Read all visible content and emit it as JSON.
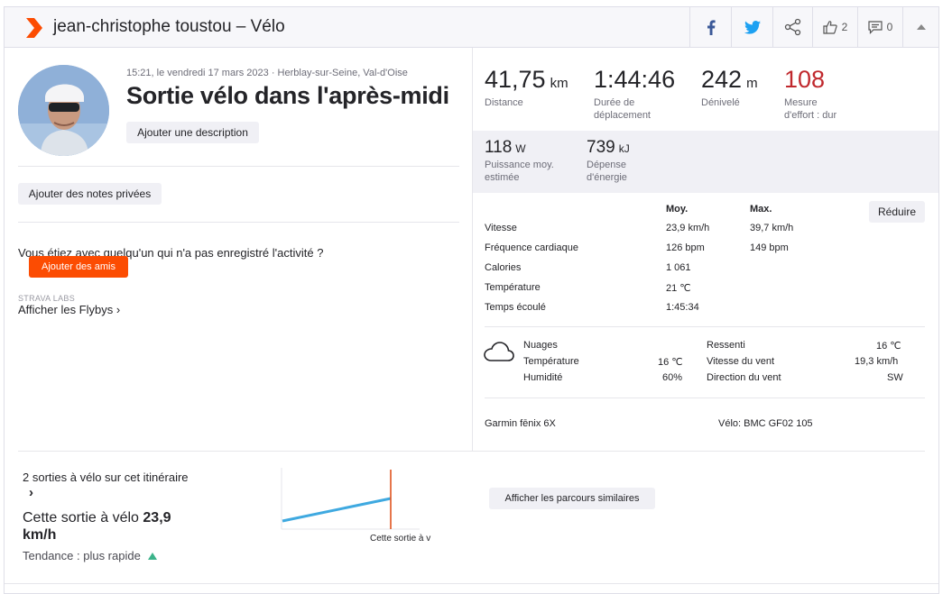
{
  "header": {
    "title": "jean-christophe toustou – Vélo",
    "kudos_count": "2",
    "comments_count": "0"
  },
  "activity": {
    "datetime_location": "15:21, le vendredi 17 mars 2023 · Herblay-sur-Seine, Val-d'Oise",
    "title": "Sortie vélo dans l'après-midi",
    "add_description": "Ajouter une description",
    "add_private_notes": "Ajouter des notes privées",
    "with_question": "Vous étiez avec quelqu'un qui n'a pas enregistré l'activité ?",
    "add_friends": "Ajouter des amis",
    "labs_label": "STRAVA LABS",
    "flybys_link": "Afficher les Flybys ›"
  },
  "stats": {
    "distance": {
      "value": "41,75",
      "unit": "km",
      "label": "Distance"
    },
    "moving_time": {
      "value": "1:44:46",
      "label": "Durée de\ndéplacement"
    },
    "elevation": {
      "value": "242",
      "unit": "m",
      "label": "Dénivelé"
    },
    "effort": {
      "value": "108",
      "label": "Mesure\nd'effort : dur"
    },
    "power": {
      "value": "118",
      "unit": "W",
      "label": "Puissance moy.\nestimée"
    },
    "energy": {
      "value": "739",
      "unit": "kJ",
      "label": "Dépense\nd'énergie"
    }
  },
  "details": {
    "col_avg": "Moy.",
    "col_max": "Max.",
    "collapse_button": "Réduire",
    "rows": [
      {
        "label": "Vitesse",
        "avg": "23,9 km/h",
        "max": "39,7 km/h"
      },
      {
        "label": "Fréquence cardiaque",
        "avg": "126 bpm",
        "max": "149 bpm"
      },
      {
        "label": "Calories",
        "avg": "1 061",
        "max": ""
      },
      {
        "label": "Température",
        "avg": "21 ℃",
        "max": ""
      },
      {
        "label": "Temps écoulé",
        "avg": "1:45:34",
        "max": ""
      }
    ]
  },
  "weather": {
    "condition": "Nuages",
    "temp_label": "Température",
    "temp_value": "16 ℃",
    "humidity_label": "Humidité",
    "humidity_value": "60%",
    "feels_label": "Ressenti",
    "feels_value": "16 ℃",
    "wind_speed_label": "Vitesse du vent",
    "wind_speed_value": "19,3 km/h",
    "wind_dir_label": "Direction du vent",
    "wind_dir_value": "SW"
  },
  "gear": {
    "device": "Garmin fēnix 6X",
    "bike": "Vélo: BMC GF02 105"
  },
  "segment_compare": {
    "rides_count": "2 sorties à vélo sur cet itinéraire",
    "chevron": "›",
    "this_ride_prefix": "Cette sortie à vélo",
    "this_ride_speed": "23,9",
    "this_ride_unit": "km/h",
    "trend": "Tendance : plus rapide",
    "chart_label": "Cette sortie à v",
    "similar_button": "Afficher les parcours similaires"
  },
  "colors": {
    "brand": "#fc4c02",
    "effort_red": "#c0282d",
    "facebook": "#3b5998",
    "twitter": "#1da1f2",
    "trend_line": "#3fa9e0",
    "trend_up": "#3cb38a"
  }
}
